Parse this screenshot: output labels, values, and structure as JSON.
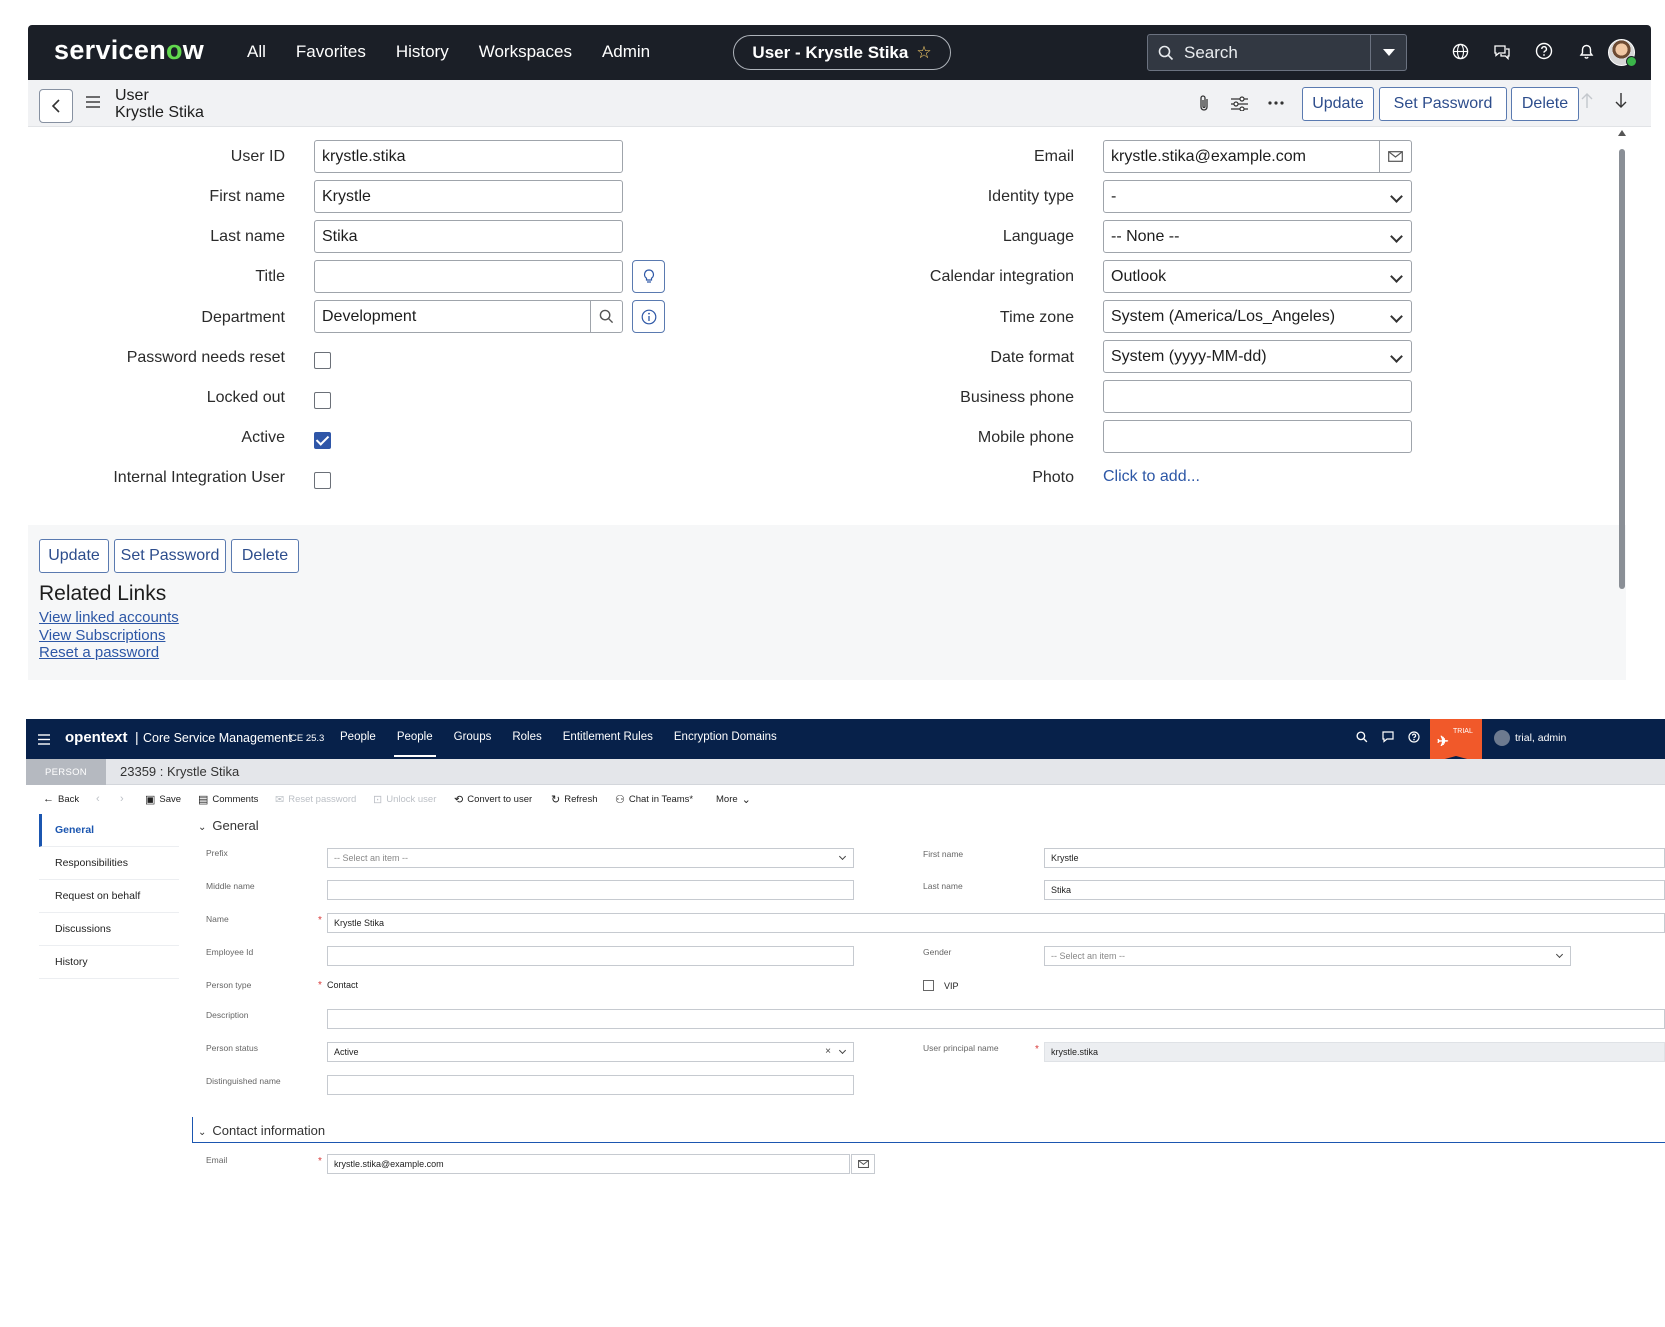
{
  "servicenow": {
    "logo": {
      "pre": "servicen",
      "o": "o",
      "post": "w"
    },
    "nav": [
      "All",
      "Favorites",
      "History",
      "Workspaces",
      "Admin"
    ],
    "context_chip": "User - Krystle Stika",
    "search_placeholder": "Search",
    "record_type": "User",
    "record_name": "Krystle Stika",
    "buttons": {
      "update": "Update",
      "set_password": "Set Password",
      "delete": "Delete"
    },
    "left_fields": {
      "user_id": {
        "label": "User ID",
        "value": "krystle.stika"
      },
      "first_name": {
        "label": "First name",
        "value": "Krystle"
      },
      "last_name": {
        "label": "Last name",
        "value": "Stika"
      },
      "title": {
        "label": "Title",
        "value": ""
      },
      "department": {
        "label": "Department",
        "value": "Development"
      },
      "password_reset": {
        "label": "Password needs reset",
        "checked": false
      },
      "locked_out": {
        "label": "Locked out",
        "checked": false
      },
      "active": {
        "label": "Active",
        "checked": true
      },
      "internal_integration": {
        "label": "Internal Integration User",
        "checked": false
      }
    },
    "right_fields": {
      "email": {
        "label": "Email",
        "value": "krystle.stika@example.com"
      },
      "identity_type": {
        "label": "Identity type",
        "value": "-"
      },
      "language": {
        "label": "Language",
        "value": "-- None --"
      },
      "calendar": {
        "label": "Calendar integration",
        "value": "Outlook"
      },
      "time_zone": {
        "label": "Time zone",
        "value": "System (America/Los_Angeles)"
      },
      "date_format": {
        "label": "Date format",
        "value": "System (yyyy-MM-dd)"
      },
      "business_phone": {
        "label": "Business phone",
        "value": ""
      },
      "mobile_phone": {
        "label": "Mobile phone",
        "value": ""
      },
      "photo": {
        "label": "Photo",
        "link": "Click to add..."
      }
    },
    "related_links": {
      "heading": "Related Links",
      "items": [
        "View linked accounts",
        "View Subscriptions",
        "Reset a password"
      ]
    },
    "accent": "#2d57a6",
    "brand_green": "#62d84e"
  },
  "opentext": {
    "brand": "opentext",
    "brand_sep": "|",
    "product": "Core Service Management",
    "version": "CE 25.3",
    "nav": [
      "People",
      "People",
      "Groups",
      "Roles",
      "Entitlement Rules",
      "Encryption Domains"
    ],
    "trial_badge": "TRIAL",
    "user": "trial, admin",
    "record_type": "PERSON",
    "record_title": "23359 : Krystle Stika",
    "toolbar": [
      "Back",
      "Save",
      "Comments",
      "Reset password",
      "Unlock user",
      "Convert to user",
      "Refresh",
      "Chat in Teams*",
      "More"
    ],
    "sidebar": [
      "General",
      "Responsibilities",
      "Request on behalf",
      "Discussions",
      "History"
    ],
    "section_general": "General",
    "section_contact": "Contact information",
    "fields": {
      "prefix": {
        "label": "Prefix",
        "value": "-- Select an item --"
      },
      "middle_name": {
        "label": "Middle name",
        "value": ""
      },
      "name": {
        "label": "Name",
        "value": "Krystle Stika"
      },
      "employee_id": {
        "label": "Employee Id",
        "value": ""
      },
      "person_type": {
        "label": "Person type",
        "value": "Contact"
      },
      "description": {
        "label": "Description",
        "value": ""
      },
      "person_status": {
        "label": "Person status",
        "value": "Active"
      },
      "distinguished_name": {
        "label": "Distinguished name",
        "value": ""
      },
      "first_name": {
        "label": "First name",
        "value": "Krystle"
      },
      "last_name": {
        "label": "Last name",
        "value": "Stika"
      },
      "gender": {
        "label": "Gender",
        "value": "-- Select an item --"
      },
      "vip": {
        "label": "VIP",
        "checked": false
      },
      "upn": {
        "label": "User principal name",
        "value": "krystle.stika"
      },
      "email": {
        "label": "Email",
        "value": "krystle.stika@example.com"
      }
    },
    "header_color": "#07214a",
    "trial_color": "#f1592a"
  }
}
